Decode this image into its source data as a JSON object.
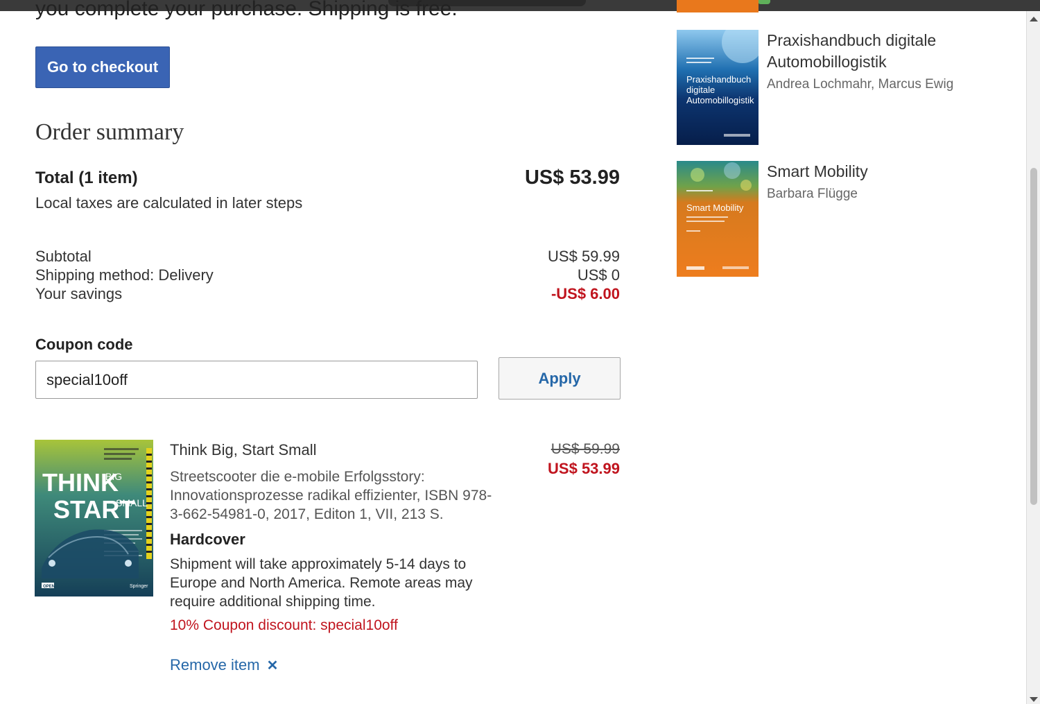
{
  "intro_text": "you complete your purchase. Shipping is free.",
  "checkout_button": "Go to checkout",
  "order_summary": {
    "title": "Order summary",
    "total_label": "Total (1 item)",
    "total_value": "US$ 53.99",
    "tax_note": "Local taxes are calculated in later steps",
    "rows": [
      {
        "label": "Subtotal",
        "value": "US$ 59.99"
      },
      {
        "label": "Shipping method: Delivery",
        "value": "US$ 0"
      },
      {
        "label": "Your savings",
        "value": "-US$ 6.00"
      }
    ]
  },
  "coupon": {
    "label": "Coupon code",
    "value": "special10off",
    "apply_label": "Apply"
  },
  "cart_item": {
    "title": "Think Big, Start Small",
    "description": "Streetscooter die e-mobile Erfolgsstory: Innovationsprozesse radikal effizienter, ISBN 978-3-662-54981-0, 2017, Editon 1, VII, 213 S.",
    "format": "Hardcover",
    "shipping_note": "Shipment will take approximately 5-14 days to Europe and North America. Remote areas may require additional shipping time.",
    "coupon_note": "10% Coupon discount: special10off",
    "remove_label": "Remove item",
    "price_original": "US$ 59.99",
    "price_discounted": "US$ 53.99",
    "cover": {
      "line1": "THINK",
      "line1_small": "BIG",
      "line2": "START",
      "line2_small": "SMALL",
      "badge": "OPEN",
      "publisher": "Springer"
    }
  },
  "recommendations": [
    {
      "title": "Praxishandbuch digitale Automobillogistik",
      "authors": "Andrea Lochmahr, Marcus Ewig",
      "cover_lines": [
        "Praxishandbuch",
        "digitale",
        "Automobillogistik"
      ]
    },
    {
      "title": "Smart Mobility",
      "authors": "Barbara Flügge",
      "cover_lines": [
        "Smart Mobility"
      ]
    }
  ],
  "colors": {
    "checkout_bg": "#3a64b4",
    "link": "#2567a8",
    "discount_red": "#c0141e"
  }
}
